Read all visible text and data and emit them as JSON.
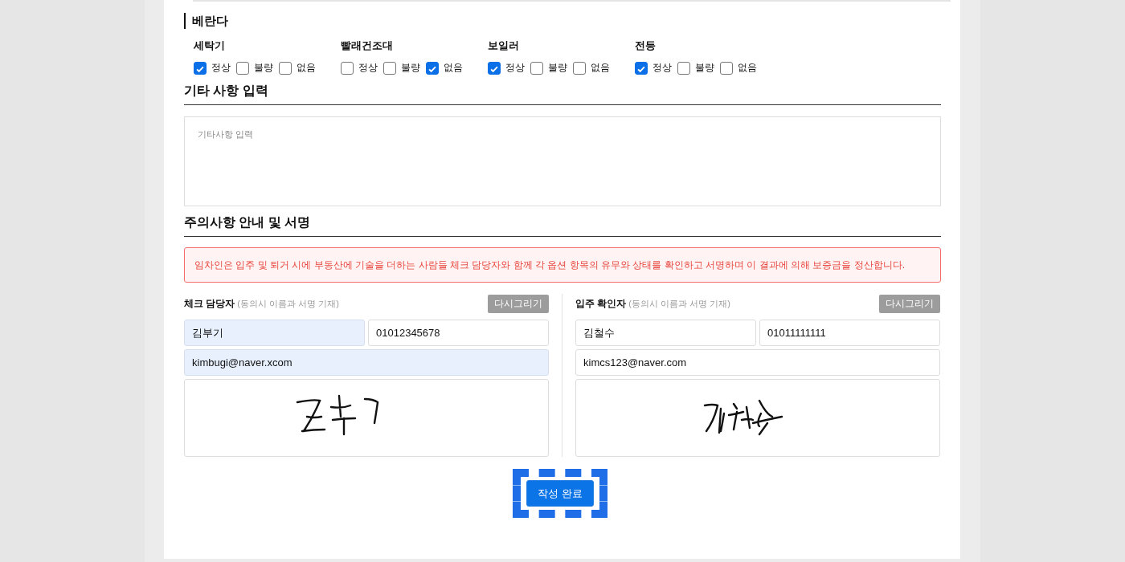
{
  "balcony": {
    "title": "베란다",
    "items": [
      {
        "name": "세탁기",
        "options": [
          {
            "label": "정상",
            "checked": true
          },
          {
            "label": "불량",
            "checked": false
          },
          {
            "label": "없음",
            "checked": false
          }
        ]
      },
      {
        "name": "빨래건조대",
        "options": [
          {
            "label": "정상",
            "checked": false
          },
          {
            "label": "불량",
            "checked": false
          },
          {
            "label": "없음",
            "checked": true
          }
        ]
      },
      {
        "name": "보일러",
        "options": [
          {
            "label": "정상",
            "checked": true
          },
          {
            "label": "불량",
            "checked": false
          },
          {
            "label": "없음",
            "checked": false
          }
        ]
      },
      {
        "name": "전등",
        "options": [
          {
            "label": "정상",
            "checked": true
          },
          {
            "label": "불량",
            "checked": false
          },
          {
            "label": "없음",
            "checked": false
          }
        ]
      }
    ]
  },
  "notes": {
    "title": "기타 사항 입력",
    "placeholder": "기타사항 입력"
  },
  "signature": {
    "title": "주의사항 안내 및 서명",
    "notice": "임차인은 입주 및 퇴거 시에 부동산에 기술을 더하는 사람들 체크 담당자와 함께 각 옵션 항목의 유무와 상태를 확인하고 서명하며 이 결과에 의해 보증금을 정산합니다.",
    "signers": [
      {
        "role": "체크 담당자",
        "hint": "(동의시 이름과 서명 기재)",
        "redraw_button": "다시그리기",
        "fields": [
          {
            "value": "김부기",
            "highlighted": true
          },
          {
            "value": "01012345678",
            "highlighted": false
          },
          {
            "value": "kimbugi@naver.xcom",
            "highlighted": true
          }
        ],
        "signed": true
      },
      {
        "role": "입주 확인자",
        "hint": "(동의시 이름과 서명 기재)",
        "redraw_button": "다시그리기",
        "fields": [
          {
            "value": "김철수",
            "highlighted": false
          },
          {
            "value": "01011111111",
            "highlighted": false
          },
          {
            "value": "kimcs123@naver.com",
            "highlighted": false
          }
        ],
        "signed": true
      }
    ]
  },
  "submit_button": {
    "label": "작성 완료",
    "focused": true
  }
}
